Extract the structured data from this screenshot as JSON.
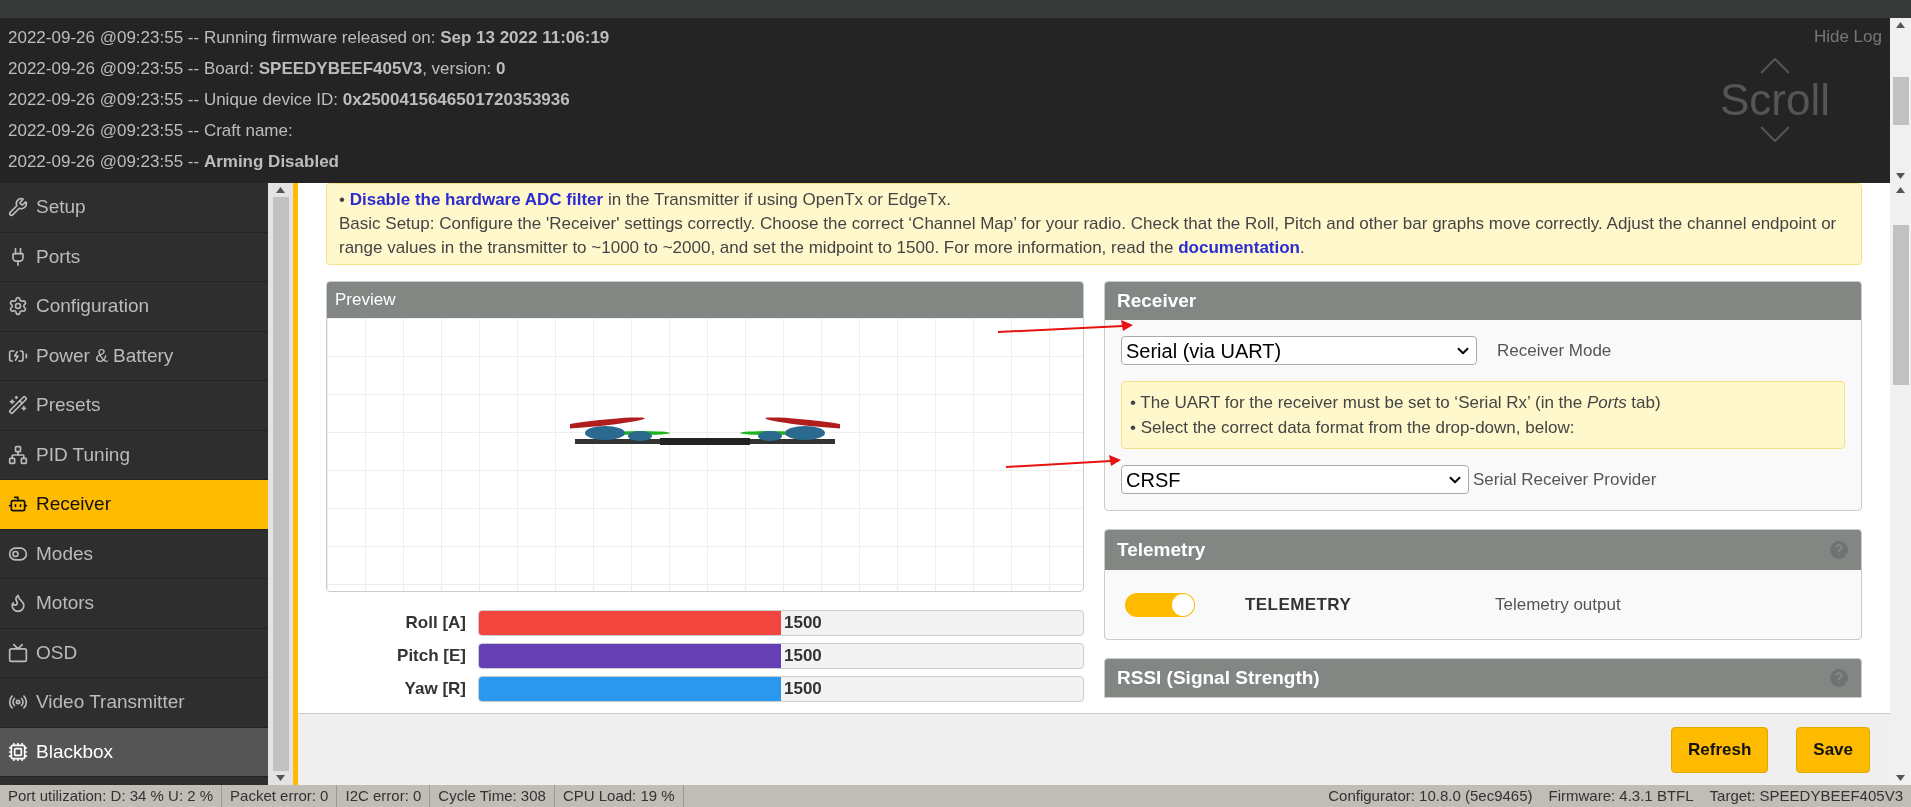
{
  "log": {
    "lines": [
      {
        "text": "2022-09-26 @09:23:55 -- Running firmware released on: **Sep 13 2022 11:06:19**"
      },
      {
        "text": "2022-09-26 @09:23:55 -- Board: **SPEEDYBEEF405V3**, version: **0**"
      },
      {
        "text": "2022-09-26 @09:23:55 -- Unique device ID: **0x2500415646501720353936**"
      },
      {
        "text": "2022-09-26 @09:23:55 -- Craft name:"
      },
      {
        "text": "2022-09-26 @09:23:55 -- **Arming Disabled**"
      }
    ],
    "hide_label": "Hide Log",
    "scroll_label": "Scroll"
  },
  "sidebar": {
    "items": [
      {
        "label": "Setup",
        "selected": false
      },
      {
        "label": "Ports",
        "selected": false
      },
      {
        "label": "Configuration",
        "selected": false
      },
      {
        "label": "Power & Battery",
        "selected": false
      },
      {
        "label": "Presets",
        "selected": false
      },
      {
        "label": "PID Tuning",
        "selected": false
      },
      {
        "label": "Receiver",
        "selected": true
      },
      {
        "label": "Modes",
        "selected": false
      },
      {
        "label": "Motors",
        "selected": false
      },
      {
        "label": "OSD",
        "selected": false
      },
      {
        "label": "Video Transmitter",
        "selected": false
      },
      {
        "label": "Blackbox",
        "selected": false
      }
    ]
  },
  "note": {
    "paragraphs": [
      {
        "parts": [
          {
            "kind": "text",
            "text": "• "
          },
          {
            "kind": "link",
            "text": "Disable the hardware ADC filter"
          },
          {
            "kind": "text",
            "text": " in the Transmitter if using OpenTx or EdgeTx."
          }
        ]
      },
      {
        "parts": [
          {
            "kind": "text",
            "text": "Basic Setup: Configure the 'Receiver' settings correctly. Choose the correct ‘Channel Map’ for your radio. Check that the Roll, Pitch and other bar graphs move correctly. Adjust the channel endpoint or range values in the transmitter to ~1000 to ~2000, and set the midpoint to 1500. For more information, read the "
          },
          {
            "kind": "link",
            "text": "documentation"
          },
          {
            "kind": "text",
            "text": "."
          }
        ]
      }
    ]
  },
  "preview": {
    "title": "Preview"
  },
  "channels": [
    {
      "name": "Roll [A]",
      "value": "1500",
      "level": 0.5,
      "color": "#f1453d"
    },
    {
      "name": "Pitch [E]",
      "value": "1500",
      "level": 0.5,
      "color": "#673fb4"
    },
    {
      "name": "Yaw [R]",
      "value": "1500",
      "level": 0.5,
      "color": "#2b98f0"
    }
  ],
  "receiver": {
    "title": "Receiver",
    "mode_value": "Serial (via UART)",
    "mode_label": "Receiver Mode",
    "info_lines": [
      "• The UART for the receiver must be set to ‘Serial Rx’ (in the *Ports* tab)",
      "• Select the correct data format from the drop-down, below:"
    ],
    "provider_value": "CRSF",
    "provider_label": "Serial Receiver Provider"
  },
  "telemetry": {
    "title": "Telemetry",
    "on": true,
    "name": "TELEMETRY",
    "description": "Telemetry output"
  },
  "rssi": {
    "title": "RSSI (Signal Strength)"
  },
  "buttons": [
    "Refresh",
    "Save"
  ],
  "status_bar": {
    "left": [
      "Port utilization: D: 34 % U: 2 %",
      "Packet error: 0",
      "I2C error: 0",
      "Cycle Time: 308",
      "CPU Load: 19 %"
    ],
    "right": [
      "Configurator: 10.8.0 (5ec9465)",
      "Firmware: 4.3.1 BTFL",
      "Target: SPEEDYBEEF405V3"
    ]
  }
}
